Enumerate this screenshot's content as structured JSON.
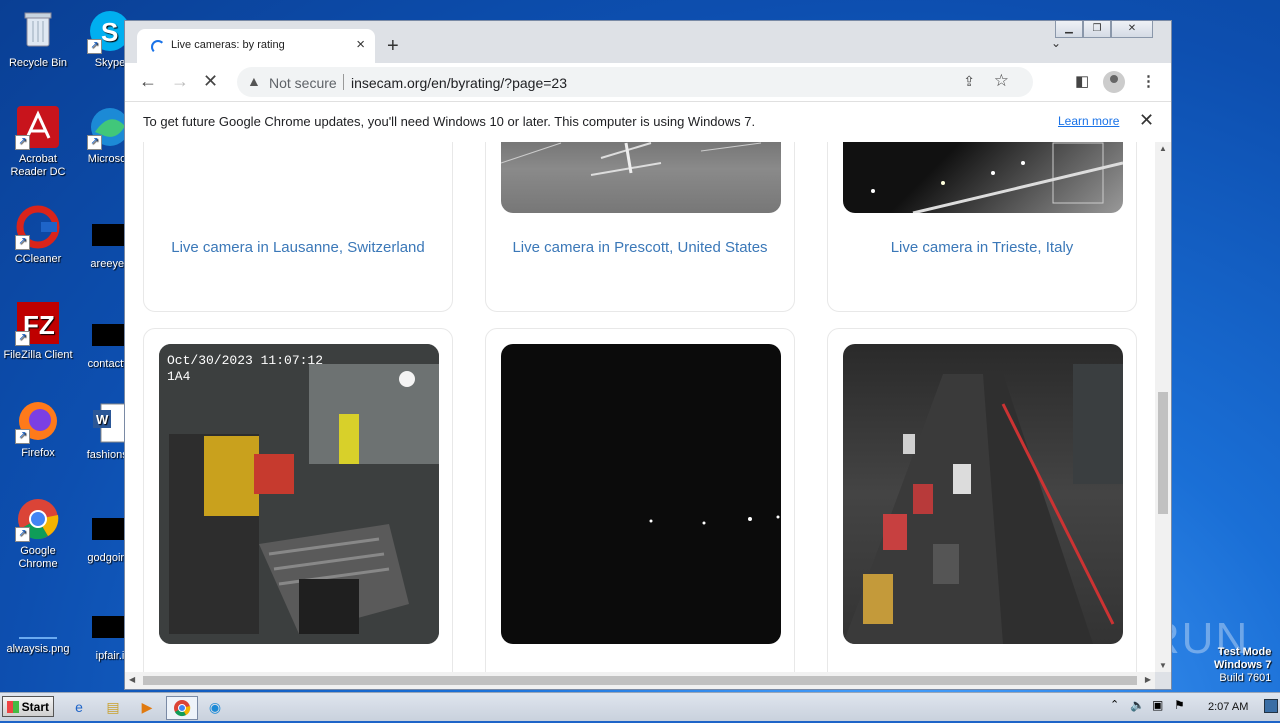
{
  "desktop": {
    "icons": [
      {
        "label": "Recycle Bin"
      },
      {
        "label": "Skype"
      },
      {
        "label": "Acrobat Reader DC"
      },
      {
        "label": "Microsoft"
      },
      {
        "label": "CCleaner"
      },
      {
        "label": "areeyes"
      },
      {
        "label": "FileZilla Client"
      },
      {
        "label": "contactfri"
      },
      {
        "label": "Firefox"
      },
      {
        "label": "fashionsy"
      },
      {
        "label": "Google Chrome"
      },
      {
        "label": "godgoing"
      },
      {
        "label": "alwaysis.png"
      },
      {
        "label": "ipfair.i"
      }
    ]
  },
  "browser": {
    "tab_title": "Live cameras: by rating",
    "new_tab_label": "+",
    "security_label": "Not secure",
    "url": "insecam.org/en/byrating/?page=23",
    "infobar": {
      "message": "To get future Google Chrome updates, you'll need Windows 10 or later. This computer is using Windows 7.",
      "link": "Learn more"
    }
  },
  "page": {
    "cards_top": [
      {
        "caption": "Live camera in Lausanne, Switzerland"
      },
      {
        "caption": "Live camera in Prescott, United States"
      },
      {
        "caption": "Live camera in Trieste, Italy"
      }
    ],
    "cards_bottom": [
      {
        "overlay": "Oct/30/2023 11:07:12",
        "overlay2": "1A4"
      },
      {
        "overlay": ""
      },
      {
        "overlay": ""
      }
    ]
  },
  "taskbar": {
    "start_label": "Start",
    "clock": "2:07 AM"
  },
  "watermark": {
    "line1": "Test Mode",
    "line2": "Windows 7",
    "line3": "Build 7601",
    "brand": "ANY RUN"
  }
}
